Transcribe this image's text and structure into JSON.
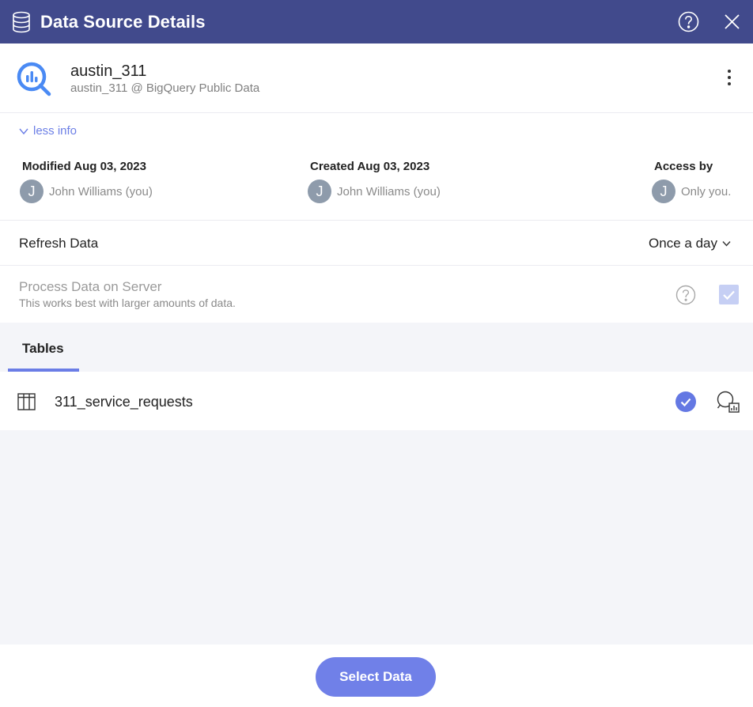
{
  "dialog": {
    "title": "Data Source Details"
  },
  "source": {
    "name": "austin_311",
    "subtitle": "austin_311 @ BigQuery Public Data"
  },
  "info": {
    "toggle_label": "less info",
    "modified": {
      "label": "Modified Aug 03, 2023",
      "avatar_initial": "J",
      "person": "John Williams (you)"
    },
    "created": {
      "label": "Created Aug 03, 2023",
      "avatar_initial": "J",
      "person": "John Williams (you)"
    },
    "access": {
      "label": "Access by",
      "avatar_initial": "J",
      "person": "Only you."
    }
  },
  "refresh": {
    "label": "Refresh Data",
    "value": "Once a day"
  },
  "process": {
    "label": "Process Data on Server",
    "description": "This works best with larger amounts of data.",
    "checked": true
  },
  "tabs": [
    {
      "label": "Tables",
      "active": true
    }
  ],
  "tables": [
    {
      "name": "311_service_requests",
      "selected": true
    }
  ],
  "footer": {
    "select_label": "Select Data"
  },
  "colors": {
    "titlebar": "#414a8c",
    "accent": "#6b7de6",
    "button": "#7080e8",
    "panel": "#f4f5f9"
  },
  "icons": {
    "title": "database-icon",
    "help": "help-circle-icon",
    "close": "close-icon",
    "source": "bigquery-icon",
    "more": "more-vertical-icon",
    "table": "table-icon",
    "selected": "check-circle-icon",
    "explore": "data-explore-icon"
  }
}
